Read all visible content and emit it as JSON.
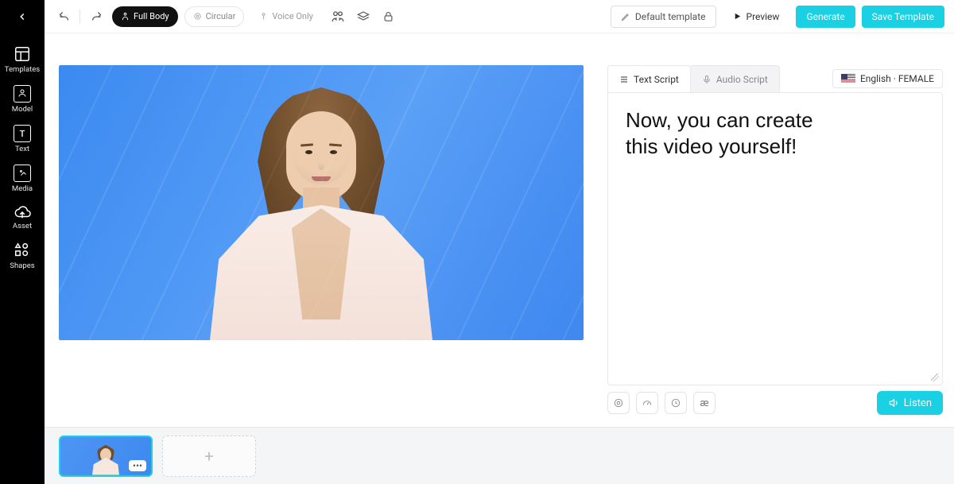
{
  "sidebar": {
    "items": [
      {
        "label": "Templates"
      },
      {
        "label": "Model"
      },
      {
        "label": "Text"
      },
      {
        "label": "Media"
      },
      {
        "label": "Asset"
      },
      {
        "label": "Shapes"
      }
    ]
  },
  "topbar": {
    "full_body": "Full Body",
    "circular": "Circular",
    "voice_only": "Voice Only",
    "default_template": "Default template",
    "preview": "Preview",
    "generate": "Generate",
    "save_template": "Save Template"
  },
  "tabs": {
    "text_script": "Text Script",
    "audio_script": "Audio Script"
  },
  "language_label": "English · FEMALE",
  "script_text": "Now, you can create\nthis video yourself!",
  "footer": {
    "pronounce_glyph": "æ",
    "listen": "Listen"
  },
  "timeline": {
    "slide_menu_glyph": "•••",
    "add_glyph": "+"
  }
}
